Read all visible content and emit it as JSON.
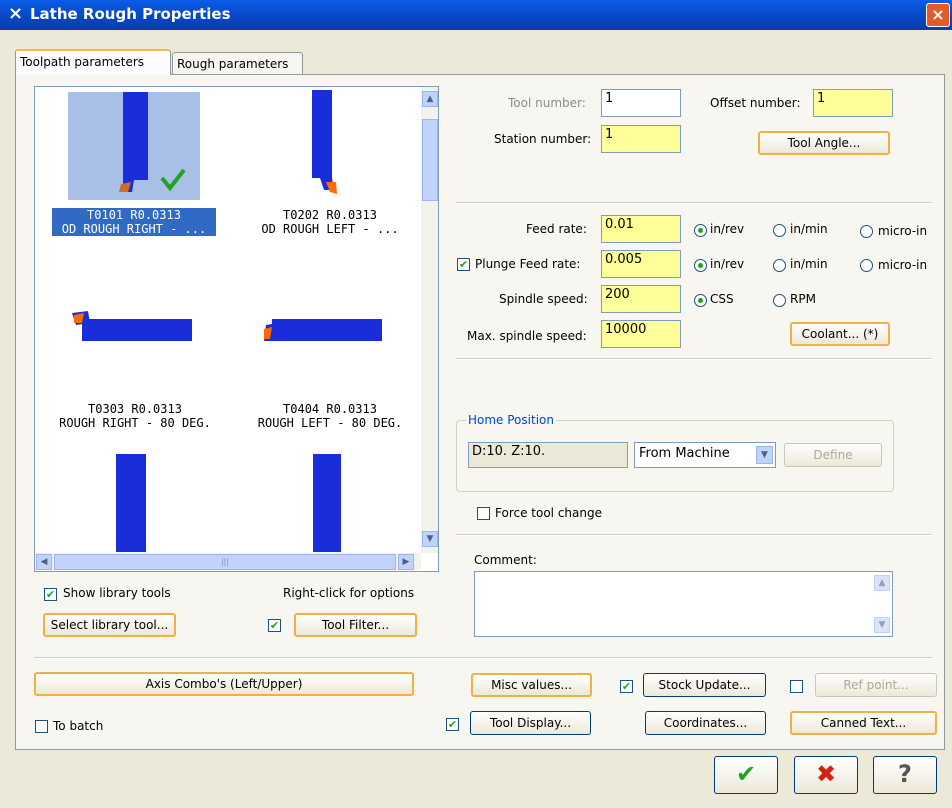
{
  "window": {
    "title": "Lathe Rough Properties",
    "icon": "x-logo-icon",
    "close": "×"
  },
  "tabs": [
    {
      "label": "Toolpath parameters"
    },
    {
      "label": "Rough parameters"
    }
  ],
  "tools": [
    {
      "line1": "T0101 R0.0313",
      "line2": "OD ROUGH RIGHT - ...",
      "selected": true
    },
    {
      "line1": "T0202 R0.0313",
      "line2": "OD ROUGH LEFT - ..."
    },
    {
      "line1": "T0303 R0.0313",
      "line2": "ROUGH RIGHT - 80 DEG."
    },
    {
      "line1": "T0404 R0.0313",
      "line2": "ROUGH LEFT - 80 DEG."
    }
  ],
  "scrollbar": {
    "up": "▲",
    "down": "▼",
    "left": "◀",
    "right": "▶",
    "grip": "|||"
  },
  "left_controls": {
    "show_library_tools": {
      "label": "Show library tools",
      "checked": true
    },
    "right_click_hint": "Right-click for options",
    "select_library_tool": "Select library tool...",
    "tool_filter": {
      "label": "Tool Filter...",
      "checked": true
    }
  },
  "tool": {
    "tool_number_label": "Tool number:",
    "tool_number": "1",
    "offset_number_label": "Offset number:",
    "offset_number": "1",
    "station_number_label": "Station number:",
    "station_number": "1",
    "tool_angle": "Tool Angle..."
  },
  "feeds": {
    "feed_rate_label": "Feed rate:",
    "feed_rate": "0.01",
    "plunge_label": "Plunge Feed rate:",
    "plunge_checked": true,
    "plunge_rate": "0.005",
    "spindle_label": "Spindle speed:",
    "spindle_speed": "200",
    "max_spindle_label": "Max. spindle speed:",
    "max_spindle": "10000",
    "coolant": "Coolant... (*)",
    "units": {
      "in_rev": "in/rev",
      "in_min": "in/min",
      "micro_in": "micro-in"
    },
    "css": "CSS",
    "rpm": "RPM"
  },
  "home": {
    "label": "Home Position",
    "value": "D:10.  Z:10.",
    "select": "From Machine",
    "define": "Define"
  },
  "force_tool_change": {
    "label": "Force tool change",
    "checked": false
  },
  "comment": {
    "label": "Comment:",
    "value": ""
  },
  "bottom": {
    "axis_combo": "Axis Combo's (Left/Upper)",
    "misc_values": "Misc values...",
    "stock_update": {
      "label": "Stock Update...",
      "checked": true
    },
    "ref_point": {
      "label": "Ref point...",
      "checked": false
    },
    "to_batch": {
      "label": "To batch",
      "checked": false
    },
    "tool_display": {
      "label": "Tool Display...",
      "checked": true
    },
    "coordinates": "Coordinates...",
    "canned_text": "Canned Text..."
  },
  "dialog_buttons": {
    "ok": "✔",
    "cancel": "✖",
    "help": "?"
  },
  "colors": {
    "tool_blue": "#1a2ddb",
    "insert_orange": "#ff6a00",
    "check_green": "#21a121",
    "selection": "#316ac5"
  }
}
